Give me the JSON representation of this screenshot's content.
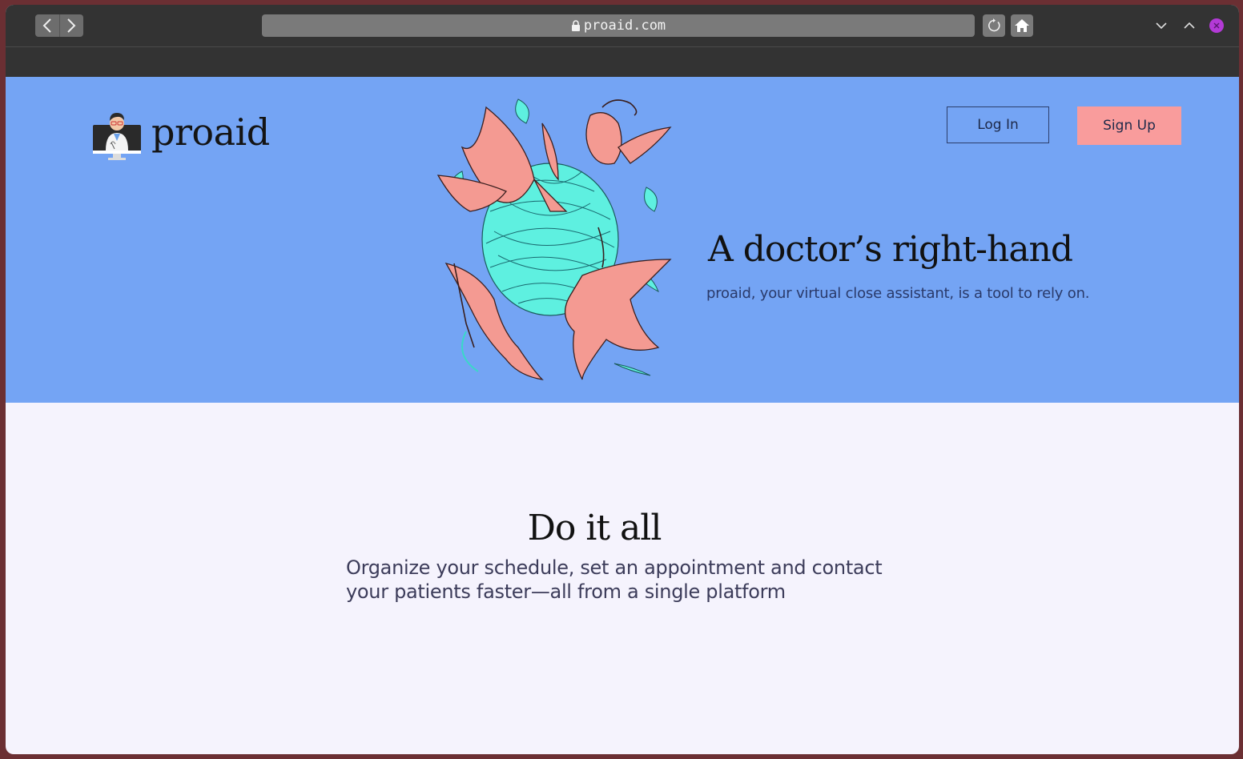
{
  "browser": {
    "url": "proaid.com",
    "icons": [
      "back-icon",
      "forward-icon",
      "lock-icon",
      "reload-icon",
      "home-icon",
      "chevron-down-icon",
      "chevron-up-icon",
      "close-icon"
    ]
  },
  "header": {
    "logo_text": "proaid",
    "login_label": "Log In",
    "signup_label": "Sign Up"
  },
  "hero": {
    "title": "A doctor’s right-hand",
    "subtitle": "proaid, your virtual close assistant, is a tool to rely on."
  },
  "features": {
    "title": "Do it all",
    "text": "Organize your schedule, set an appointment and contact your patients faster—all from a single platform"
  },
  "colors": {
    "hero_bg": "#74a4f4",
    "signup_bg": "#f99c9c",
    "page_bg": "#f5f3fd",
    "chrome_bg": "#333333",
    "close_button": "#b33ad6"
  }
}
